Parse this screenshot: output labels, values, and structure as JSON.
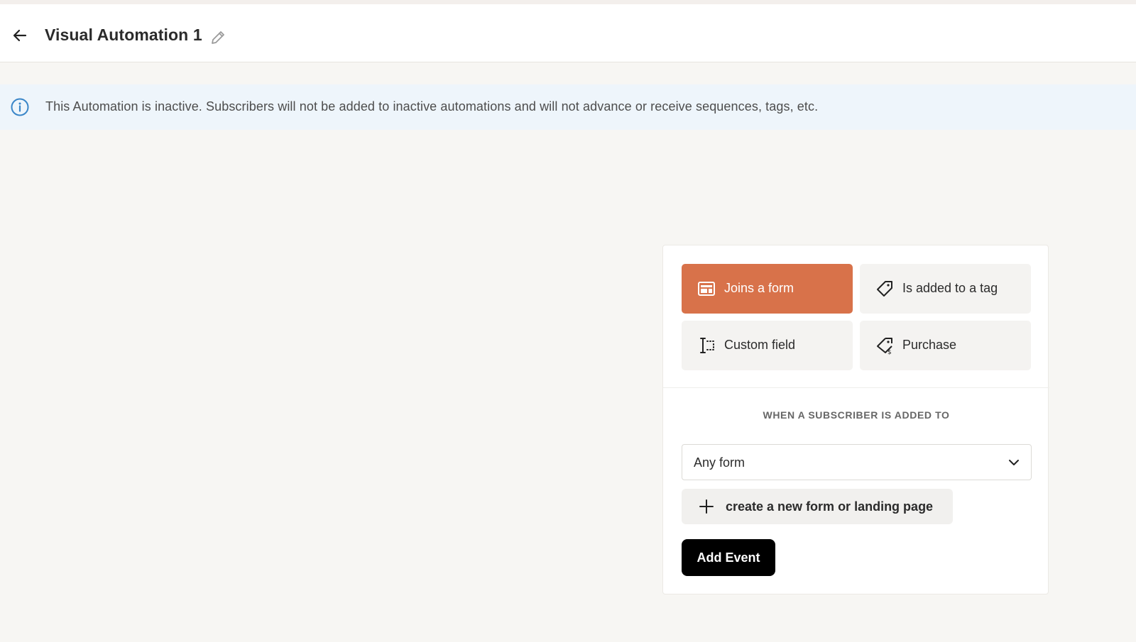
{
  "header": {
    "title": "Visual Automation 1",
    "back_icon": "arrow-left-icon",
    "edit_icon": "pencil-icon"
  },
  "banner": {
    "icon": "info-icon",
    "message": "This Automation is inactive. Subscribers will not be added to inactive automations and will not advance or receive sequences, tags, etc."
  },
  "event_panel": {
    "options": [
      {
        "label": "Joins a form",
        "icon": "form-icon",
        "active": true
      },
      {
        "label": "Is added to a tag",
        "icon": "tag-icon",
        "active": false
      },
      {
        "label": "Custom field",
        "icon": "custom-field-icon",
        "active": false
      },
      {
        "label": "Purchase",
        "icon": "purchase-tag-icon",
        "active": false
      }
    ],
    "section_label": "WHEN A SUBSCRIBER IS ADDED TO",
    "form_select": {
      "value": "Any form"
    },
    "create_label": "create a new form or landing page",
    "add_event_label": "Add Event"
  },
  "colors": {
    "accent": "#d8724a",
    "background": "#f7f6f3",
    "banner": "#eef5fb",
    "info_blue": "#3a86c8"
  }
}
